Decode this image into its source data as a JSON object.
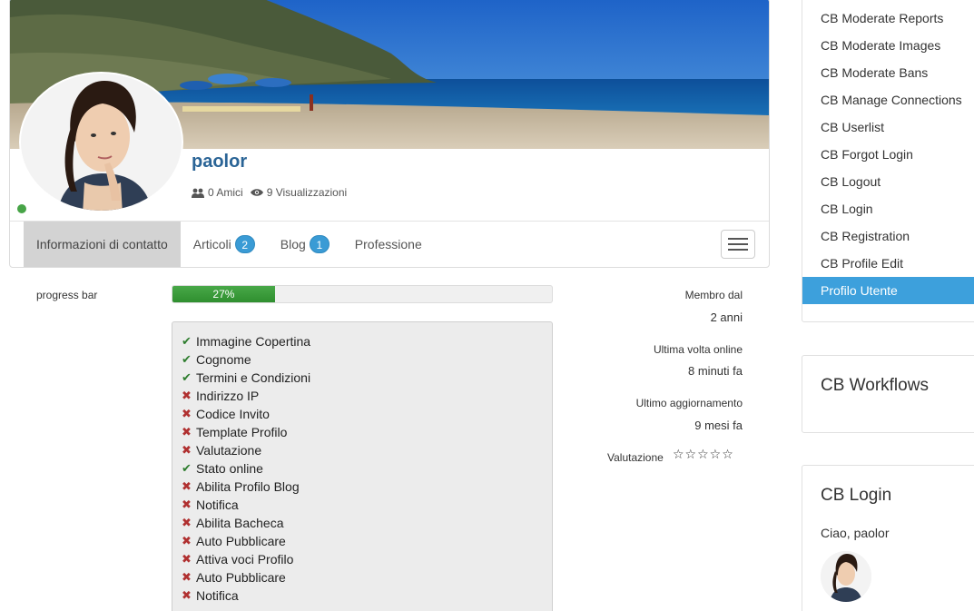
{
  "profile": {
    "username": "paolor",
    "friends": "0 Amici",
    "views": "9 Visualizzazioni",
    "status_online_color": "#47a447"
  },
  "tabs": [
    {
      "label": "Informazioni di contatto",
      "badge": null,
      "active": true
    },
    {
      "label": "Articoli",
      "badge": "2",
      "active": false
    },
    {
      "label": "Blog",
      "badge": "1",
      "active": false
    },
    {
      "label": "Professione",
      "badge": null,
      "active": false
    }
  ],
  "progress": {
    "label": "progress bar",
    "text": "27%",
    "value": 27
  },
  "checklist": [
    {
      "label": "Immagine Copertina",
      "done": true
    },
    {
      "label": "Cognome",
      "done": true
    },
    {
      "label": "Termini e Condizioni",
      "done": true
    },
    {
      "label": "Indirizzo IP",
      "done": false
    },
    {
      "label": "Codice Invito",
      "done": false
    },
    {
      "label": "Template Profilo",
      "done": false
    },
    {
      "label": "Valutazione",
      "done": false
    },
    {
      "label": "Stato online",
      "done": true
    },
    {
      "label": "Abilita Profilo Blog",
      "done": false
    },
    {
      "label": "Notifica",
      "done": false
    },
    {
      "label": "Abilita Bacheca",
      "done": false
    },
    {
      "label": "Auto Pubblicare",
      "done": false
    },
    {
      "label": "Attiva voci Profilo",
      "done": false
    },
    {
      "label": "Auto Pubblicare",
      "done": false
    },
    {
      "label": "Notifica",
      "done": false
    }
  ],
  "info": {
    "member_since_label": "Membro dal",
    "member_since_value": "2 anni",
    "last_online_label": "Ultima volta online",
    "last_online_value": "8 minuti fa",
    "last_update_label": "Ultimo aggiornamento",
    "last_update_value": "9 mesi fa",
    "rating_label": "Valutazione",
    "rating_stars": "☆☆☆☆☆"
  },
  "sidebar": {
    "menu": [
      {
        "label": "CB Moderate Reports",
        "active": false
      },
      {
        "label": "CB Moderate Images",
        "active": false
      },
      {
        "label": "CB Moderate Bans",
        "active": false
      },
      {
        "label": "CB Manage Connections",
        "active": false
      },
      {
        "label": "CB Userlist",
        "active": false
      },
      {
        "label": "CB Forgot Login",
        "active": false
      },
      {
        "label": "CB Logout",
        "active": false
      },
      {
        "label": "CB Login",
        "active": false
      },
      {
        "label": "CB Registration",
        "active": false
      },
      {
        "label": "CB Profile Edit",
        "active": false
      },
      {
        "label": "Profilo Utente",
        "active": true
      }
    ],
    "workflows_title": "CB Workflows",
    "login_title": "CB Login",
    "greeting": "Ciao, paolor"
  },
  "colors": {
    "accent": "#3da0dc",
    "link": "#2a6496",
    "progress": "#3a9a3a",
    "check_ok": "#2e7d2e",
    "check_ko": "#b03030"
  }
}
